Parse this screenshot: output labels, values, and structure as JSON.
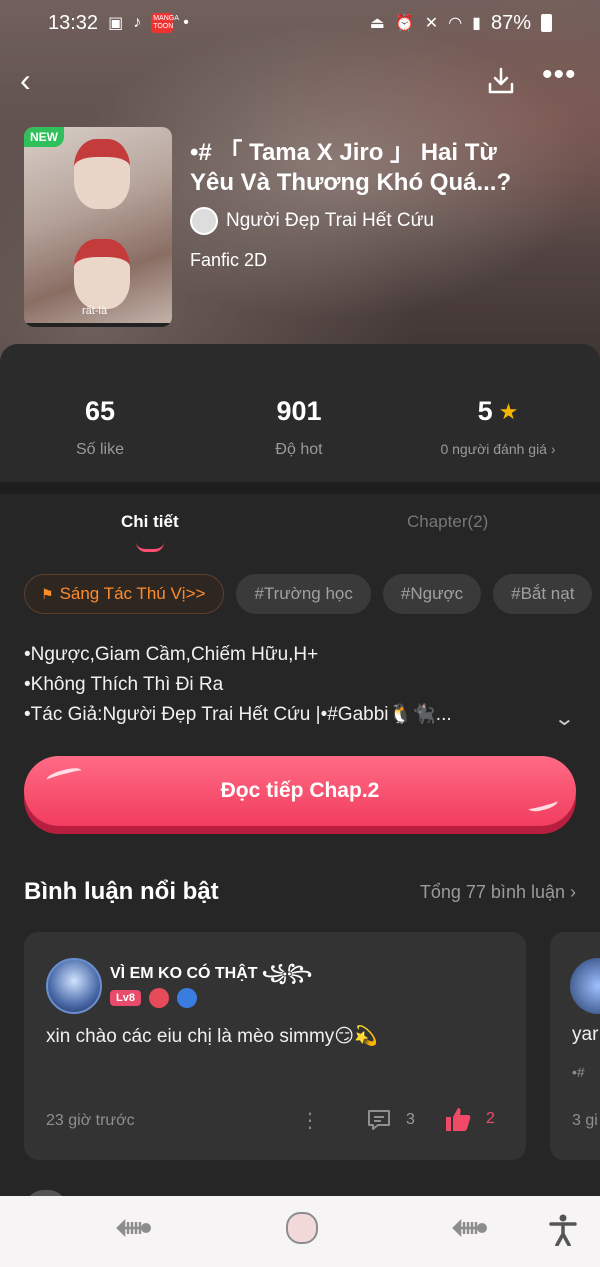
{
  "status_bar": {
    "time": "13:32",
    "manga_icon_text": "MANGA TOON",
    "battery": "87%"
  },
  "top_bar": {
    "back_icon": "‹",
    "more_icon": "•••"
  },
  "work": {
    "new_badge": "NEW",
    "cover_caption": "rất-là",
    "title": "•# 「 Tama X Jiro 」 Hai Từ Yêu Và Thương Khó Quá...?",
    "author": "Người Đẹp Trai Hết Cứu",
    "genre": "Fanfic 2D"
  },
  "stats": {
    "likes_value": "65",
    "likes_label": "Số like",
    "hot_value": "901",
    "hot_label": "Độ hot",
    "rating_value": "5",
    "rating_label": "0 người đánh giá ›"
  },
  "tabs": {
    "detail": "Chi tiết",
    "chapter": "Chapter(2)"
  },
  "tags": {
    "featured": "Sáng Tác Thú Vị>>",
    "t1": "#Trường học",
    "t2": "#Ngược",
    "t3": "#Bắt nạt"
  },
  "description": {
    "line1": "•Ngược,Giam Cầm,Chiếm Hữu,H+",
    "line2": "•Không Thích Thì Đi Ra",
    "line3": "•Tác Giả:Người Đẹp Trai Hết Cứu |•#Gabbi🐧🐈‍⬛..."
  },
  "read_button": "Đọc tiếp Chap.2",
  "comments_section": {
    "title": "Bình luận nổi bật",
    "total_link": "Tổng 77 bình luận  ›"
  },
  "comment1": {
    "name": "VÌ EM KO CÓ THẬT ꧁꧂",
    "level": "Lv8",
    "text": "xin chào các eiu chị là mèo simmy😏💫",
    "time": "23 giờ trước",
    "reply_count": "3",
    "like_count": "2"
  },
  "comment2": {
    "text": "yar",
    "sub": "•#",
    "time": "3 gi"
  },
  "colors": {
    "accent": "#f23d5f",
    "featured_tag": "#ff8c2a",
    "star": "#f7b500",
    "background": "#262626"
  }
}
